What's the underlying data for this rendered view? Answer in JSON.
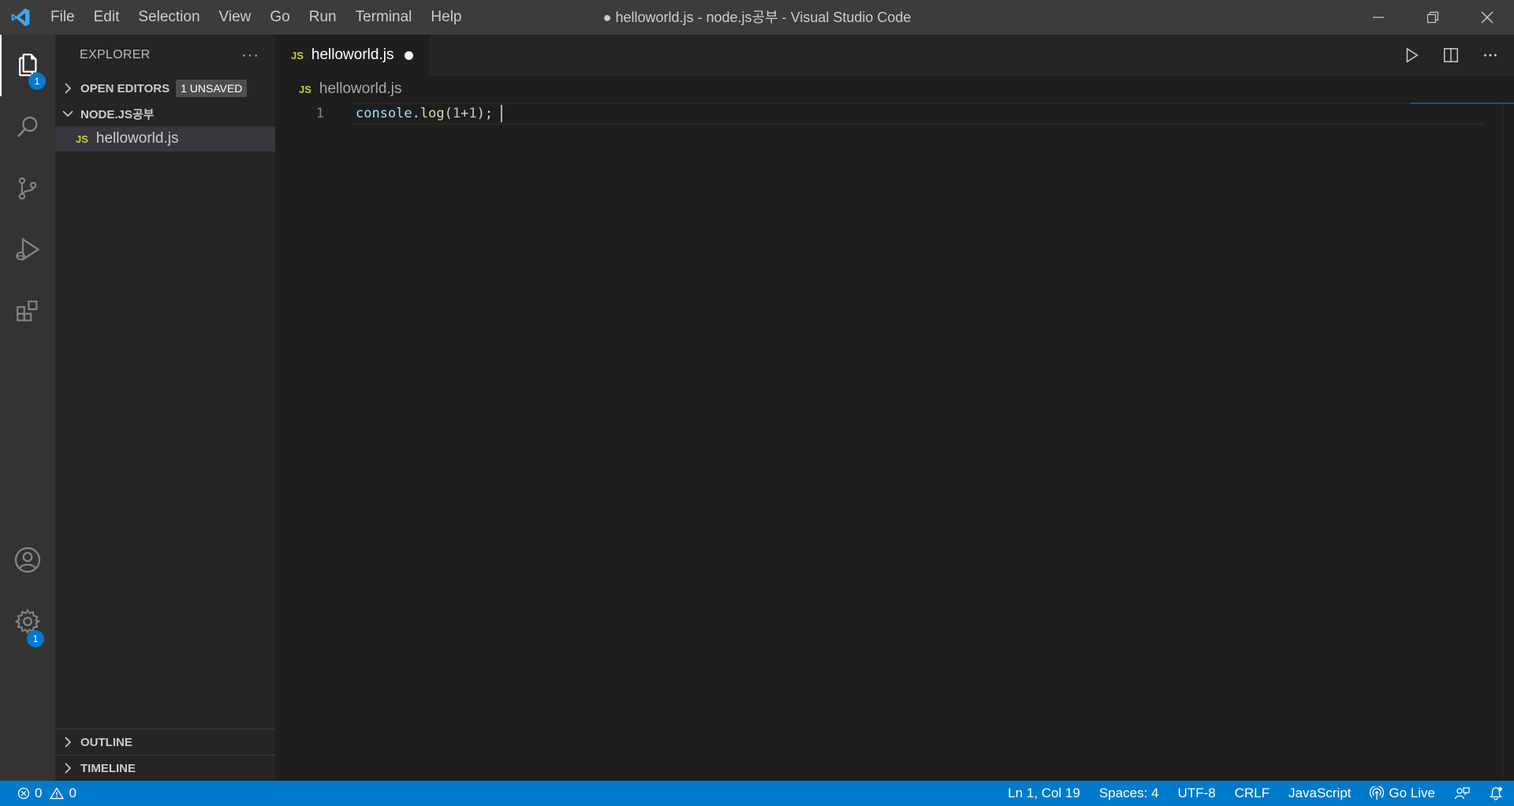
{
  "titlebar": {
    "window_title": "● helloworld.js - node.js공부 - Visual Studio Code",
    "menu": [
      "File",
      "Edit",
      "Selection",
      "View",
      "Go",
      "Run",
      "Terminal",
      "Help"
    ]
  },
  "activity_bar": {
    "explorer_badge": "1",
    "settings_badge": "1"
  },
  "sidebar": {
    "title": "EXPLORER",
    "more_label": "···",
    "open_editors": {
      "label": "OPEN EDITORS",
      "badge": "1 UNSAVED"
    },
    "folder": {
      "label": "NODE.JS공부"
    },
    "files": [
      {
        "icon_label": "JS",
        "name": "helloworld.js"
      }
    ],
    "outline_label": "OUTLINE",
    "timeline_label": "TIMELINE"
  },
  "editor": {
    "tab": {
      "icon_label": "JS",
      "name": "helloworld.js",
      "dirty": true
    },
    "breadcrumb": {
      "icon_label": "JS",
      "file": "helloworld.js"
    },
    "lines": [
      {
        "number": "1",
        "tokens": {
          "object": "console",
          "dot": ".",
          "method": "log",
          "open": "(",
          "a": "1",
          "op": "+",
          "b": "1",
          "close": ");"
        }
      }
    ]
  },
  "statusbar": {
    "errors": "0",
    "warnings": "0",
    "position": "Ln 1, Col 19",
    "spaces": "Spaces: 4",
    "encoding": "UTF-8",
    "eol": "CRLF",
    "language": "JavaScript",
    "go_live": "Go Live"
  },
  "colors": {
    "accent": "#007acc",
    "titlebar": "#3c3c3c",
    "activitybar": "#333333",
    "sidebar": "#252526",
    "editor": "#1e1e1e",
    "js_icon": "#cbcb41"
  },
  "icons": [
    "vscode-logo-icon",
    "files-icon",
    "search-icon",
    "source-control-icon",
    "run-debug-icon",
    "extensions-icon",
    "account-icon",
    "settings-gear-icon",
    "run-icon",
    "split-editor-icon",
    "more-icon",
    "error-icon",
    "warning-icon",
    "broadcast-icon",
    "feedback-icon",
    "bell-icon"
  ]
}
